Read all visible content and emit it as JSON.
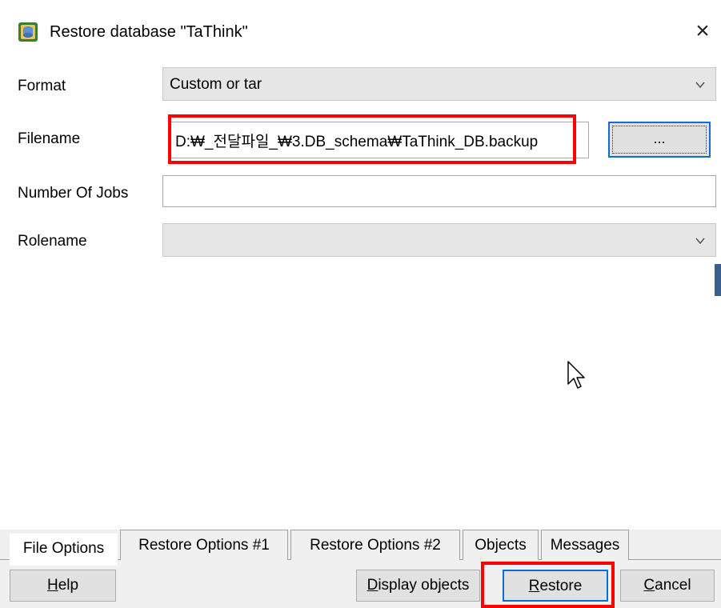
{
  "window": {
    "title": "Restore database \"TaThink\"",
    "close_glyph": "×"
  },
  "icons": {
    "app": "database-restore-icon",
    "close": "close-icon",
    "dropdown": "chevron-down-icon",
    "cursor": "mouse-pointer-icon"
  },
  "form": {
    "format": {
      "label": "Format",
      "value": "Custom or tar"
    },
    "filename": {
      "label": "Filename",
      "value": "D:₩_전달파일_₩3.DB_schema₩TaThink_DB.backup",
      "browse_label": "..."
    },
    "jobs": {
      "label": "Number Of Jobs",
      "value": ""
    },
    "rolename": {
      "label": "Rolename",
      "value": ""
    }
  },
  "tabs": [
    {
      "label": "File Options",
      "active": true
    },
    {
      "label": "Restore Options #1",
      "active": false
    },
    {
      "label": "Restore Options #2",
      "active": false
    },
    {
      "label": "Objects",
      "active": false
    },
    {
      "label": "Messages",
      "active": false
    }
  ],
  "buttons": {
    "help": {
      "label": "Help",
      "mnemonic": "H",
      "rest": "elp"
    },
    "display_objects": {
      "label": "Display objects",
      "mnemonic": "D",
      "rest": "isplay objects"
    },
    "restore": {
      "label": "Restore",
      "mnemonic": "R",
      "rest": "estore"
    },
    "cancel": {
      "label": "Cancel",
      "mnemonic": "C",
      "rest": "ancel"
    }
  },
  "colors": {
    "highlight": "#ff0000",
    "focus": "#0a6ed6",
    "background": "#f0f0f0"
  }
}
